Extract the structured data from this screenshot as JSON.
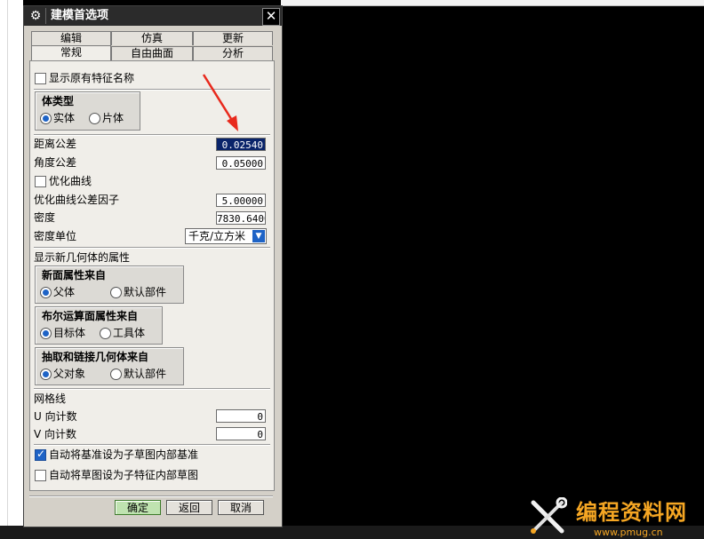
{
  "window": {
    "title": "建模首选项",
    "close_glyph": "✕",
    "gear_glyph": "⚙"
  },
  "tabs": {
    "row1": [
      "编辑",
      "仿真",
      "更新"
    ],
    "row2": [
      "常规",
      "自由曲面",
      "分析"
    ],
    "active": "常规"
  },
  "general": {
    "show_original_feature_name": {
      "label": "显示原有特征名称",
      "checked": false
    },
    "body_type": {
      "title": "体类型",
      "options": [
        "实体",
        "片体"
      ],
      "selected": "实体"
    },
    "distance_tolerance": {
      "label": "距离公差",
      "value": "0.02540"
    },
    "angle_tolerance": {
      "label": "角度公差",
      "value": "0.05000"
    },
    "optimize_curve": {
      "label": "优化曲线",
      "checked": false
    },
    "optimize_curve_factor": {
      "label": "优化曲线公差因子",
      "value": "5.00000"
    },
    "density": {
      "label": "密度",
      "value": "7830.6400"
    },
    "density_unit": {
      "label": "密度单位",
      "value": "千克/立方米"
    },
    "new_geometry_attrs": {
      "label": "显示新几何体的属性"
    },
    "face_attrs_from": {
      "title": "新面属性来自",
      "options": [
        "父体",
        "默认部件"
      ],
      "selected": "父体"
    },
    "boolean_face_attrs_from": {
      "title": "布尔运算面属性来自",
      "options": [
        "目标体",
        "工具体"
      ],
      "selected": "目标体"
    },
    "extract_link_from": {
      "title": "抽取和链接几何体来自",
      "options": [
        "父对象",
        "默认部件"
      ],
      "selected": "父对象"
    },
    "grid_lines": {
      "label": "网格线"
    },
    "u_count": {
      "label": "U 向计数",
      "value": "0"
    },
    "v_count": {
      "label": "V 向计数",
      "value": "0"
    },
    "auto_datum": {
      "label": "自动将基准设为子草图内部基准",
      "checked": true
    },
    "auto_sketch": {
      "label": "自动将草图设为子特征内部草图",
      "checked": false
    }
  },
  "buttons": {
    "ok": "确定",
    "back": "返回",
    "cancel": "取消"
  },
  "watermark": {
    "title": "编程资料网",
    "url": "www.pmug.cn"
  },
  "colors": {
    "accent": "#1e63c6",
    "selection": "#0a246a",
    "annotation_arrow": "#e8291c",
    "watermark": "#f5a623"
  }
}
